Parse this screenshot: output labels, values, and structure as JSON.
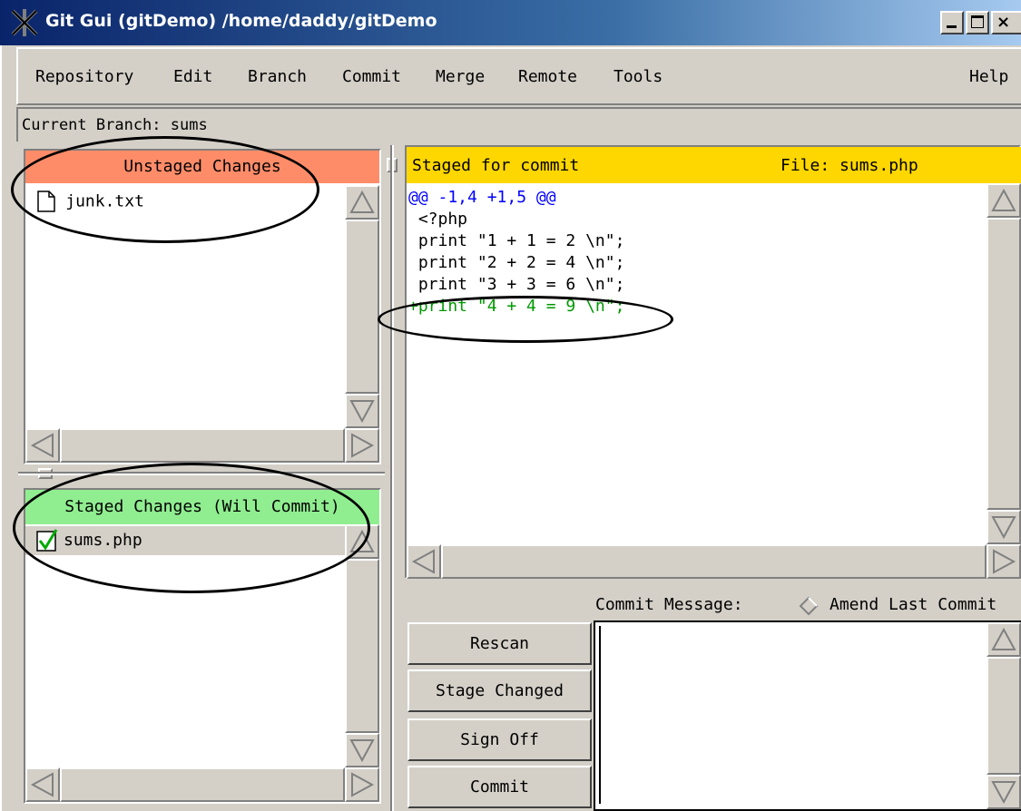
{
  "window": {
    "title": "Git Gui (gitDemo) /home/daddy/gitDemo",
    "title_color": "#ffffff",
    "title_gradient": [
      "#0a246a",
      "#a6caf0"
    ]
  },
  "menu": {
    "items": [
      "Repository",
      "Edit",
      "Branch",
      "Commit",
      "Merge",
      "Remote",
      "Tools"
    ],
    "help": "Help"
  },
  "branch": {
    "text": "Current Branch: sums"
  },
  "unstaged": {
    "header": "Unstaged Changes",
    "header_color": "#ff8c69",
    "files": [
      {
        "name": "junk.txt",
        "icon": "document-icon"
      }
    ]
  },
  "staged": {
    "header": "Staged Changes (Will Commit)",
    "header_color": "#90ee90",
    "files": [
      {
        "name": "sums.php",
        "icon": "checkmark-icon"
      }
    ]
  },
  "diff": {
    "header_left": "Staged for commit",
    "header_right": "File: sums.php",
    "header_color": "#ffd700",
    "lines": [
      {
        "text": "@@ -1,4 +1,5 @@",
        "kind": "hunk",
        "color": "#0000ff"
      },
      {
        "text": " <?php",
        "kind": "context",
        "color": "#000000"
      },
      {
        "text": " print \"1 + 1 = 2 \\n\";",
        "kind": "context",
        "color": "#000000"
      },
      {
        "text": " print \"2 + 2 = 4 \\n\";",
        "kind": "context",
        "color": "#000000"
      },
      {
        "text": " print \"3 + 3 = 6 \\n\";",
        "kind": "context",
        "color": "#000000"
      },
      {
        "text": "+print \"4 + 4 = 9 \\n\";",
        "kind": "added",
        "color": "#009900"
      }
    ]
  },
  "commit": {
    "message_label": "Commit Message:",
    "amend_label": "Amend Last Commit",
    "message_value": "",
    "buttons": [
      "Rescan",
      "Stage Changed",
      "Sign Off",
      "Commit"
    ]
  }
}
